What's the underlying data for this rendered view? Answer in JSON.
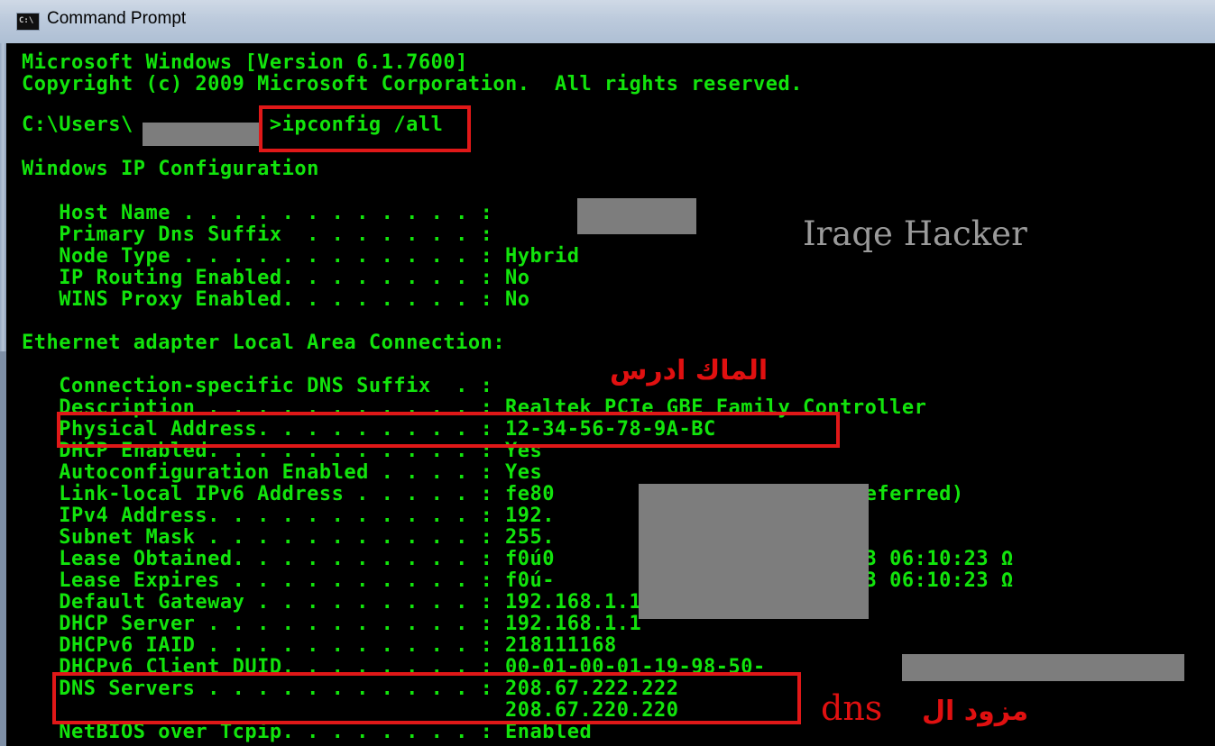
{
  "window": {
    "icon_text": "C:\\",
    "title": "Command Prompt"
  },
  "console": {
    "lines": [
      "Microsoft Windows [Version 6.1.7600]",
      "Copyright (c) 2009 Microsoft Corporation.  All rights reserved.",
      "",
      "C:\\Users\\           >ipconfig /all",
      "",
      "Windows IP Configuration",
      "",
      "   Host Name . . . . . . . . . . . . :",
      "   Primary Dns Suffix  . . . . . . . :",
      "   Node Type . . . . . . . . . . . . : Hybrid",
      "   IP Routing Enabled. . . . . . . . : No",
      "   WINS Proxy Enabled. . . . . . . . : No",
      "",
      "Ethernet adapter Local Area Connection:",
      "",
      "   Connection-specific DNS Suffix  . :",
      "   Description . . . . . . . . . . . : Realtek PCIe GBE Family Controller",
      "   Physical Address. . . . . . . . . : 12-34-56-78-9A-BC",
      "   DHCP Enabled. . . . . . . . . . . : Yes",
      "   Autoconfiguration Enabled . . . . : Yes",
      "   Link-local IPv6 Address . . . . . : fe80               1d46%12(Preferred)",
      "   IPv4 Address. . . . . . . . . . . : 192.               ed)",
      "   Subnet Mask . . . . . . . . . . . : 255.",
      "   Lease Obtained. . . . . . . . . . : f0ú0               08 08, 2013 06:10:23 Ω",
      "   Lease Expires . . . . . . . . . . : f0ú-               08 09, 2013 06:10:23 Ω",
      "   Default Gateway . . . . . . . . . : 192.168.1.1",
      "   DHCP Server . . . . . . . . . . . : 192.168.1.1",
      "   DHCPv6 IAID . . . . . . . . . . . : 218111168",
      "   DHCPv6 Client DUID. . . . . . . . : 00-01-00-01-19-98-50-",
      "   DNS Servers . . . . . . . . . . . : 208.67.222.222",
      "                                       208.67.220.220",
      "   NetBIOS over Tcpip. . . . . . . . : Enabled"
    ]
  },
  "overlay": {
    "watermark": "Iraqe Hacker",
    "mac_label": "الماك ادرس",
    "dns_label_latin": "dns",
    "dns_label_arabic": "مزود ال"
  },
  "colors": {
    "console_text": "#12e40c",
    "console_bg": "#000000",
    "highlight_box": "#e01818",
    "redaction": "#7d7d7d"
  }
}
